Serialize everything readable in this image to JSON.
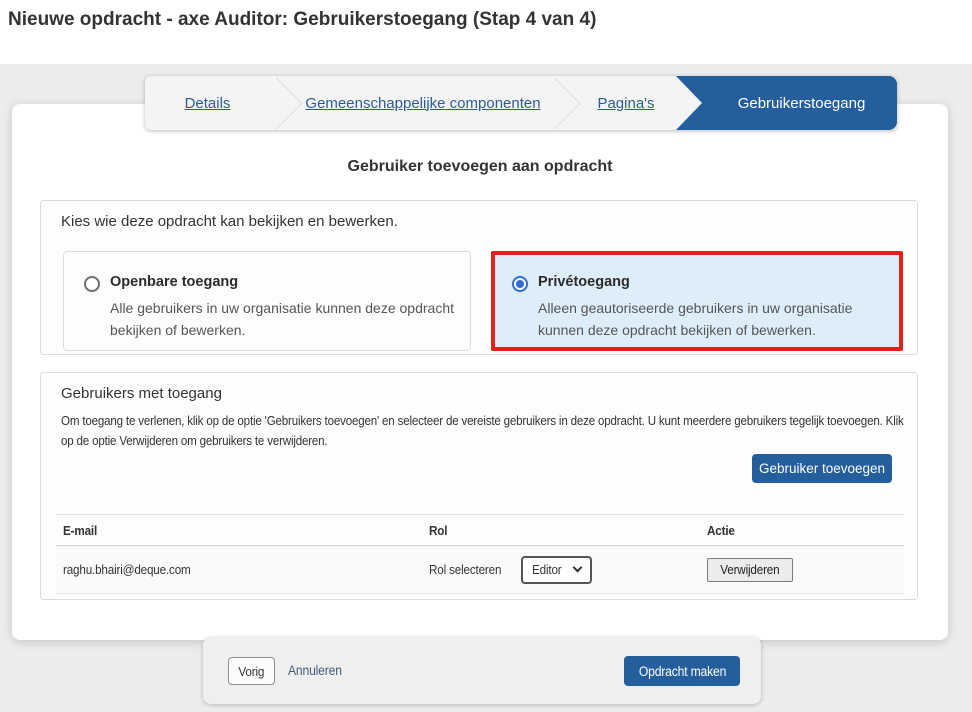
{
  "page": {
    "title": "Nieuwe opdracht - axe Auditor: Gebruikerstoegang (Stap 4 van 4)"
  },
  "colors": {
    "accent_blue": "#245e9c",
    "link_blue": "#2a5d97",
    "highlight_red_border": "#e02419",
    "highlight_blue_bg": "#ddeefa"
  },
  "wizard": {
    "steps": [
      {
        "label": "Details",
        "state": "link"
      },
      {
        "label": "Gemeenschappelijke componenten",
        "state": "link"
      },
      {
        "label": "Pagina's",
        "state": "link"
      },
      {
        "label": "Gebruikerstoegang",
        "state": "active"
      }
    ]
  },
  "main": {
    "heading": "Gebruiker toevoegen aan opdracht",
    "access_section": {
      "label": "Kies wie deze opdracht kan bekijken en bewerken.",
      "options": [
        {
          "title": "Openbare toegang",
          "description": "Alle gebruikers in uw organisatie kunnen deze opdracht bekijken of bewerken.",
          "selected": false
        },
        {
          "title": "Privétoegang",
          "description": "Alleen geautoriseerde gebruikers in uw organisatie kunnen deze opdracht bekijken of bewerken.",
          "selected": true,
          "highlighted": true
        }
      ]
    },
    "users_section": {
      "label": "Gebruikers met toegang",
      "description": "Om toegang te verlenen, klik op de optie 'Gebruikers toevoegen' en selecteer de vereiste gebruikers in deze opdracht. U kunt meerdere gebruikers tegelijk toevoegen. Klik op de optie Verwijderen om gebruikers te verwijderen.",
      "add_button_label": "Gebruiker toevoegen",
      "table": {
        "headers": {
          "email": "E-mail",
          "role": "Rol",
          "action": "Actie"
        },
        "rows": [
          {
            "email": "raghu.bhairi@deque.com",
            "role_label": "Rol selecteren",
            "role_value": "Editor",
            "action_label": "Verwijderen"
          }
        ]
      }
    }
  },
  "footer": {
    "previous_label": "Vorig",
    "cancel_label": "Annuleren",
    "submit_label": "Opdracht maken"
  },
  "icons": {
    "select_chevron": "chevron-down-icon",
    "step_separator": "chevron-right-separator"
  }
}
